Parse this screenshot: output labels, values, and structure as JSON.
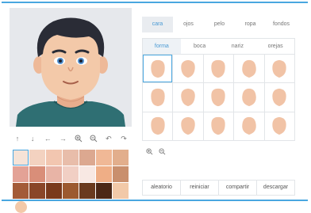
{
  "tabs": [
    {
      "label": "cara",
      "active": true
    },
    {
      "label": "ojos",
      "active": false
    },
    {
      "label": "pelo",
      "active": false
    },
    {
      "label": "ropa",
      "active": false
    },
    {
      "label": "fondos",
      "active": false
    }
  ],
  "subtabs": [
    {
      "label": "forma",
      "active": true
    },
    {
      "label": "boca",
      "active": false
    },
    {
      "label": "nariz",
      "active": false
    },
    {
      "label": "orejas",
      "active": false
    }
  ],
  "toolbar": {
    "icons": [
      "arrow-up-icon",
      "arrow-down-icon",
      "arrow-left-icon",
      "arrow-right-icon",
      "zoom-in-icon",
      "zoom-out-icon",
      "undo-icon",
      "redo-icon"
    ]
  },
  "zoom_icons": [
    "zoom-in-icon",
    "zoom-out-icon"
  ],
  "palette": {
    "colors": [
      "#f6e3d7",
      "#f3d2c0",
      "#f2c6b0",
      "#e8bdaa",
      "#dca890",
      "#f0b896",
      "#e2ae8c",
      "#e3a296",
      "#d98e79",
      "#e8b4a6",
      "#f1cfc4",
      "#f8e8e3",
      "#efae86",
      "#c98f6d",
      "#a35b38",
      "#8a4628",
      "#7a3a1c",
      "#9c5a30",
      "#6a3a1e",
      "#4c2816",
      "#f2c9a8"
    ],
    "selected_index": 0,
    "skin_tone": "#f3c9a9"
  },
  "face_shapes": {
    "count": 15,
    "selected_index": 0,
    "fill": "#f1c3a6"
  },
  "actions": [
    {
      "label": "aleatorio"
    },
    {
      "label": "reiniciar"
    },
    {
      "label": "compartir"
    },
    {
      "label": "descargar"
    }
  ],
  "colors": {
    "accent": "#49a7e0",
    "hair": "#2a2c36",
    "shirt": "#2f6f73",
    "background": "#e6e8ec"
  }
}
